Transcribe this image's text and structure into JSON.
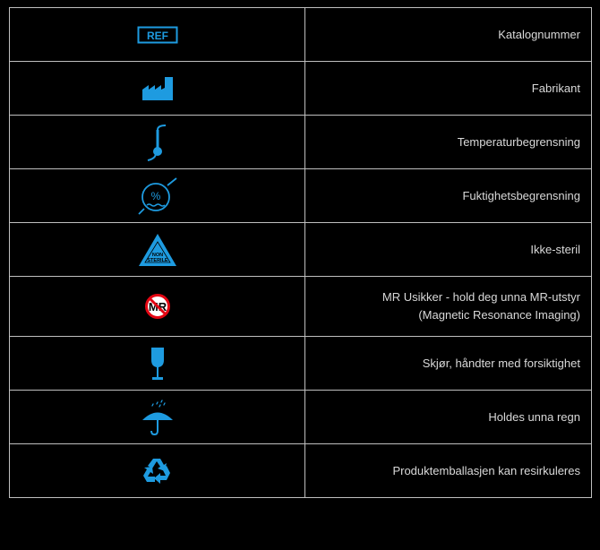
{
  "colors": {
    "background": "#000000",
    "icon_blue": "#1e9be0",
    "border": "#bfbfbf",
    "text": "#d9d9d9",
    "no_sign_red": "#e30613"
  },
  "rows": [
    {
      "icon": "ref-icon",
      "icon_text": "REF",
      "label": "Katalognummer"
    },
    {
      "icon": "factory-icon",
      "label": "Fabrikant"
    },
    {
      "icon": "thermometer-icon",
      "label": "Temperaturbegrensning"
    },
    {
      "icon": "humidity-icon",
      "icon_text": "%",
      "label": "Fuktighetsbegrensning"
    },
    {
      "icon": "non-sterile-icon",
      "icon_text": [
        "NON",
        "STERILE"
      ],
      "label": "Ikke-steril"
    },
    {
      "icon": "mr-unsafe-icon",
      "icon_text": "MR",
      "label_lines": [
        "MR Usikker - hold deg unna MR-utstyr",
        "(Magnetic Resonance Imaging)"
      ]
    },
    {
      "icon": "fragile-glass-icon",
      "label": "Skjør, håndter med forsiktighet"
    },
    {
      "icon": "umbrella-rain-icon",
      "label": "Holdes unna regn"
    },
    {
      "icon": "recycle-icon",
      "label": "Produktemballasjen kan resirkuleres"
    }
  ]
}
